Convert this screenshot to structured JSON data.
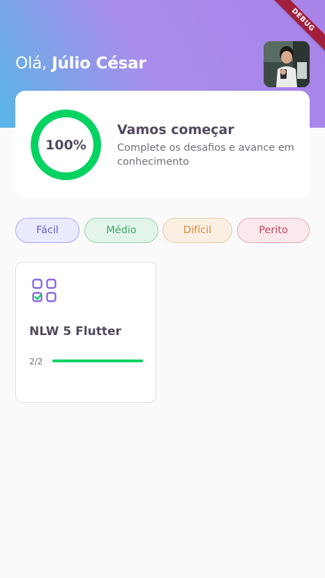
{
  "header": {
    "greeting_prefix": "Olá,",
    "user_name": "Júlio César",
    "avatar_alt": "avatar"
  },
  "debug_banner": "DEBUG",
  "score_card": {
    "percent_label": "100%",
    "percent_value": 1.0,
    "title": "Vamos começar",
    "subtitle": "Complete os desafios e avance em conhecimento"
  },
  "levels": [
    {
      "label": "Fácil"
    },
    {
      "label": "Médio"
    },
    {
      "label": "Difícil"
    },
    {
      "label": "Perito"
    }
  ],
  "quizzes": [
    {
      "title": "NLW 5 Flutter",
      "progress_text": "2/2",
      "progress_value": 1.0,
      "icon": "quiz-data-icon"
    }
  ],
  "colors": {
    "accent_green": "#04D361",
    "purple": "#8257E5",
    "text_primary": "#52495E"
  }
}
